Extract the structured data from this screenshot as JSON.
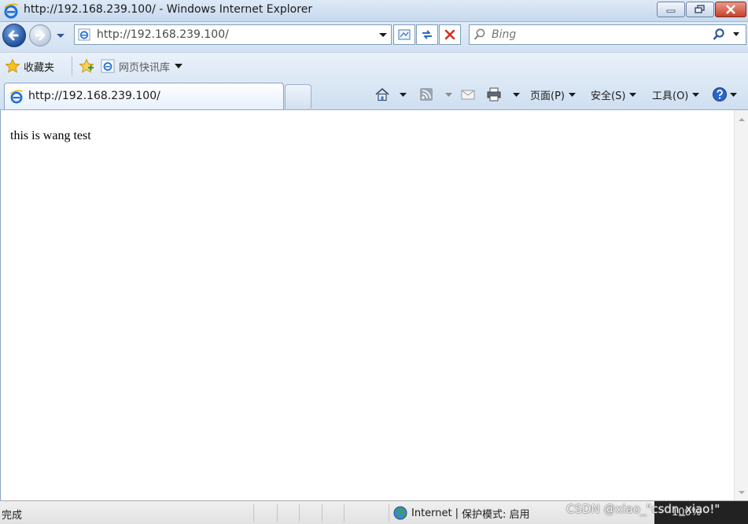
{
  "window": {
    "title": "http://192.168.239.100/ - Windows Internet Explorer"
  },
  "navigation": {
    "address_value": "http://192.168.239.100/",
    "search_placeholder": "Bing"
  },
  "favorites_bar": {
    "favorites_label": "收藏夹",
    "web_slice_label": "网页快讯库"
  },
  "tabs": [
    {
      "label": "http://192.168.239.100/",
      "active": true
    }
  ],
  "command_bar": {
    "page_label": "页面(P)",
    "safety_label": "安全(S)",
    "tools_label": "工具(O)"
  },
  "page": {
    "body_text": "this is wang test"
  },
  "status_bar": {
    "status_text": "完成",
    "zone_label": "Internet",
    "separator": "|",
    "protected_mode_label": "保护模式: 启用",
    "zoom_text": "100%"
  },
  "watermark": {
    "text": "CSDN @xiao_\"csdn_xiao!\""
  },
  "colors": {
    "chrome_blue": "#cfe0f3",
    "close_red": "#c7412b",
    "ie_blue": "#1e6fd9"
  },
  "icons": {
    "title_icon": "ie-logo-icon",
    "back": "back-arrow-icon",
    "forward": "forward-arrow-icon",
    "refresh": "refresh-icon",
    "stop": "stop-icon",
    "search": "search-icon",
    "favorites": "star-icon",
    "home": "home-icon",
    "feeds": "rss-icon",
    "mail": "mail-icon",
    "print": "printer-icon",
    "help": "help-icon",
    "zone": "globe-icon"
  }
}
